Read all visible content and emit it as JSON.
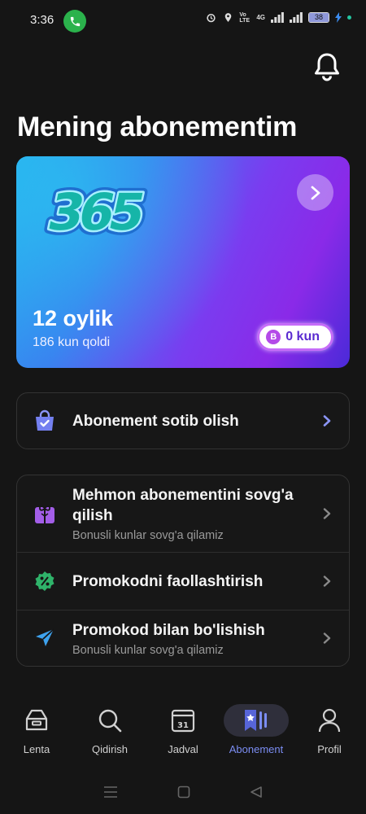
{
  "status_bar": {
    "time": "3:36",
    "battery": "38",
    "network": "4G",
    "volte": "Vo LTE"
  },
  "header": {
    "title": "Mening abonementim"
  },
  "subscription": {
    "logo_text": "365",
    "plan": "12 oylik",
    "remaining": "186 kun qoldi",
    "bonus_badge": "B",
    "bonus": "0 kun"
  },
  "buy": {
    "label": "Abonement sotib olish"
  },
  "menu": [
    {
      "title": "Mehmon abonementini sovg'a qilish",
      "subtitle": "Bonusli kunlar sovg'a qilamiz"
    },
    {
      "title": "Promokodni faollashtirish",
      "subtitle": ""
    },
    {
      "title": "Promokod bilan bo'lishish",
      "subtitle": "Bonusli kunlar sovg'a qilamiz"
    }
  ],
  "bottom_nav": [
    {
      "label": "Lenta",
      "icon": "feed-icon",
      "active": false
    },
    {
      "label": "Qidirish",
      "icon": "search-icon",
      "active": false
    },
    {
      "label": "Jadval",
      "icon": "calendar-icon",
      "active": false,
      "icon_text": "31"
    },
    {
      "label": "Abonement",
      "icon": "subscription-icon",
      "active": true
    },
    {
      "label": "Profil",
      "icon": "profile-icon",
      "active": false
    }
  ],
  "colors": {
    "accent": "#7b8df2",
    "background": "#151515",
    "bonus": "#b44ae8"
  }
}
